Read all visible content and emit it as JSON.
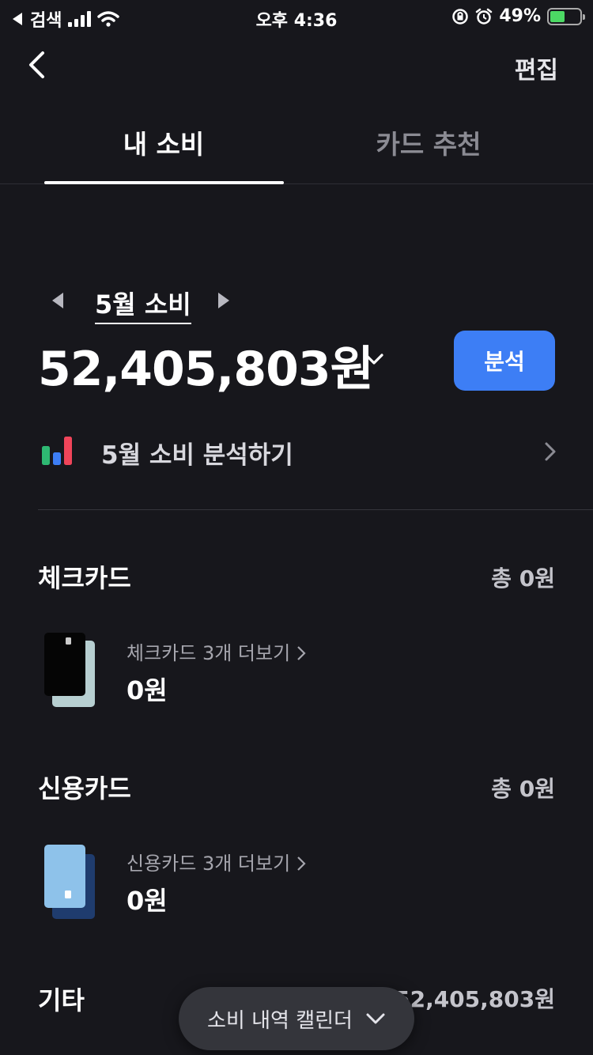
{
  "status_bar": {
    "back_app": "검색",
    "time": "오후 4:36",
    "battery_percent": "49%",
    "battery_level": 0.49,
    "icons": [
      "back-triangle-icon",
      "signal-icon",
      "wifi-icon",
      "orientation-lock-icon",
      "alarm-icon",
      "battery-charging-icon"
    ]
  },
  "header": {
    "edit_label": "편집"
  },
  "tabs": [
    {
      "label": "내 소비",
      "active": true
    },
    {
      "label": "카드 추천",
      "active": false
    }
  ],
  "summary": {
    "month_label": "5월 소비",
    "total": "52,405,803원",
    "analyze_button": "분석"
  },
  "analysis_row": {
    "label": "5월 소비 분석하기"
  },
  "sections": {
    "check": {
      "title": "체크카드",
      "total": "총 0원",
      "link": "체크카드 3개 더보기",
      "amount": "0원"
    },
    "credit": {
      "title": "신용카드",
      "total": "총 0원",
      "link": "신용카드 3개 더보기",
      "amount": "0원"
    },
    "other": {
      "title": "기타",
      "total": "총 52,405,803원"
    }
  },
  "calendar_pill": {
    "label": "소비 내역 캘린더"
  },
  "colors": {
    "background": "#17171c",
    "accent": "#3d7ef5",
    "chart_green": "#2eb872",
    "chart_blue": "#3d7ef5",
    "chart_red": "#f0455a"
  }
}
